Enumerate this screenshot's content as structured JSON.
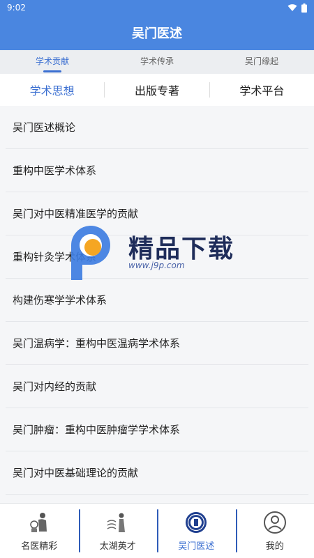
{
  "status_bar": {
    "time": "9:02"
  },
  "app_bar": {
    "title": "吴门医述"
  },
  "tabs": [
    {
      "label": "学术贡献",
      "active": true
    },
    {
      "label": "学术传承",
      "active": false
    },
    {
      "label": "吴门缘起",
      "active": false
    }
  ],
  "subtabs": [
    {
      "label": "学术思想",
      "active": true
    },
    {
      "label": "出版专著",
      "active": false
    },
    {
      "label": "学术平台",
      "active": false
    }
  ],
  "list_items": [
    "吴门医述概论",
    "重构中医学术体系",
    "吴门对中医精准医学的贡献",
    "重构针灸学术体系",
    "构建伤寒学学术体系",
    "吴门温病学：重构中医温病学术体系",
    "吴门对内经的贡献",
    "吴门肿瘤：重构中医肿瘤学学术体系",
    "吴门对中医基础理论的贡献"
  ],
  "watermark": {
    "title": "精品下载",
    "url": "www.j9p.com"
  },
  "bottom_nav": [
    {
      "label": "名医精彩",
      "icon": "doctor-figure-icon",
      "active": false
    },
    {
      "label": "太湖英才",
      "icon": "taihu-figure-icon",
      "active": false
    },
    {
      "label": "吴门医述",
      "icon": "seal-emblem-icon",
      "active": true
    },
    {
      "label": "我的",
      "icon": "user-profile-icon",
      "active": false
    }
  ],
  "colors": {
    "primary": "#4a86e0",
    "accent": "#3b6fd1"
  }
}
